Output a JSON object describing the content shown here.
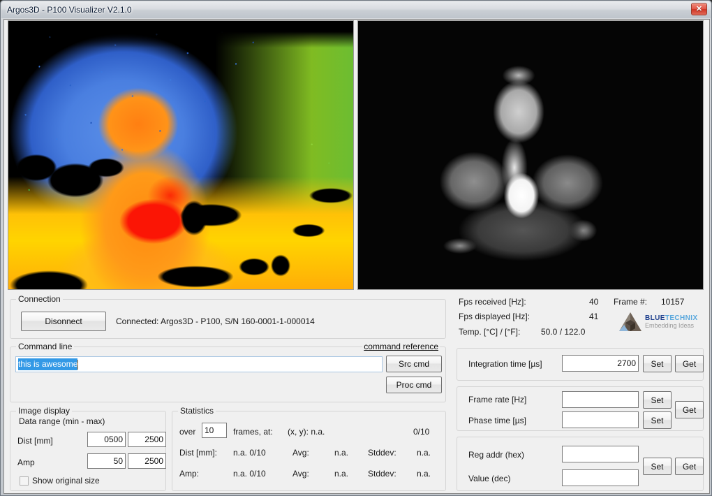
{
  "window": {
    "title": "Argos3D - P100 Visualizer V2.1.0",
    "close_label": "✕"
  },
  "images": {
    "depth": {
      "name": "depth-colormap-image",
      "alt": "Depth image, jet colormap, person giving thumbs up"
    },
    "amplitude": {
      "name": "amplitude-grayscale-image",
      "alt": "Grayscale amplitude image, person giving thumbs up"
    }
  },
  "connection": {
    "legend": "Connection",
    "disconnect_label": "Disonnect",
    "status": "Connected: Argos3D - P100, S/N 160-0001-1-000014"
  },
  "command_line": {
    "legend": "Command line",
    "reference_link": "command reference",
    "input_value": "this is awesome",
    "src_cmd_label": "Src cmd",
    "proc_cmd_label": "Proc cmd"
  },
  "image_display": {
    "legend": "Image display",
    "data_range_label": "Data range (min - max)",
    "dist_label": "Dist [mm]",
    "dist_min": "0500",
    "dist_max": "2500",
    "amp_label": "Amp",
    "amp_min": "50",
    "amp_max": "2500",
    "show_original_size_label": "Show original size",
    "show_original_size_checked": false
  },
  "statistics": {
    "legend": "Statistics",
    "over_label": "over",
    "frames_value": "10",
    "frames_at_label": "frames, at:",
    "xy_label": "(x, y): n.a.",
    "counter": "0/10",
    "rows": [
      {
        "label": "Dist [mm]:",
        "value": "n.a. 0/10",
        "avg_label": "Avg:",
        "avg_value": "n.a.",
        "stddev_label": "Stddev:",
        "stddev_value": "n.a."
      },
      {
        "label": "Amp:",
        "value": "n.a. 0/10",
        "avg_label": "Avg:",
        "avg_value": "n.a.",
        "stddev_label": "Stddev:",
        "stddev_value": "n.a."
      }
    ]
  },
  "status": {
    "fps_received_label": "Fps received [Hz]:",
    "fps_received_value": "40",
    "fps_displayed_label": "Fps displayed [Hz]:",
    "fps_displayed_value": "41",
    "temp_label": "Temp. [°C] / [°F]:",
    "temp_value": "50.0 / 122.0",
    "frame_label": "Frame #:",
    "frame_value": "10157"
  },
  "logo": {
    "brand_blue": "BLUE",
    "brand_technix": "TECHNIX",
    "tagline": "Embedding Ideas"
  },
  "integration": {
    "label": "Integration time [µs]",
    "value": "2700",
    "set_label": "Set",
    "get_label": "Get"
  },
  "timing": {
    "frame_rate_label": "Frame rate [Hz]",
    "frame_rate_value": "",
    "phase_time_label": "Phase time [µs]",
    "phase_time_value": "",
    "set_label": "Set",
    "get_label": "Get"
  },
  "register": {
    "reg_addr_label": "Reg addr (hex)",
    "reg_addr_value": "",
    "value_label": "Value (dec)",
    "value_value": "",
    "set_label": "Set",
    "get_label": "Get"
  }
}
